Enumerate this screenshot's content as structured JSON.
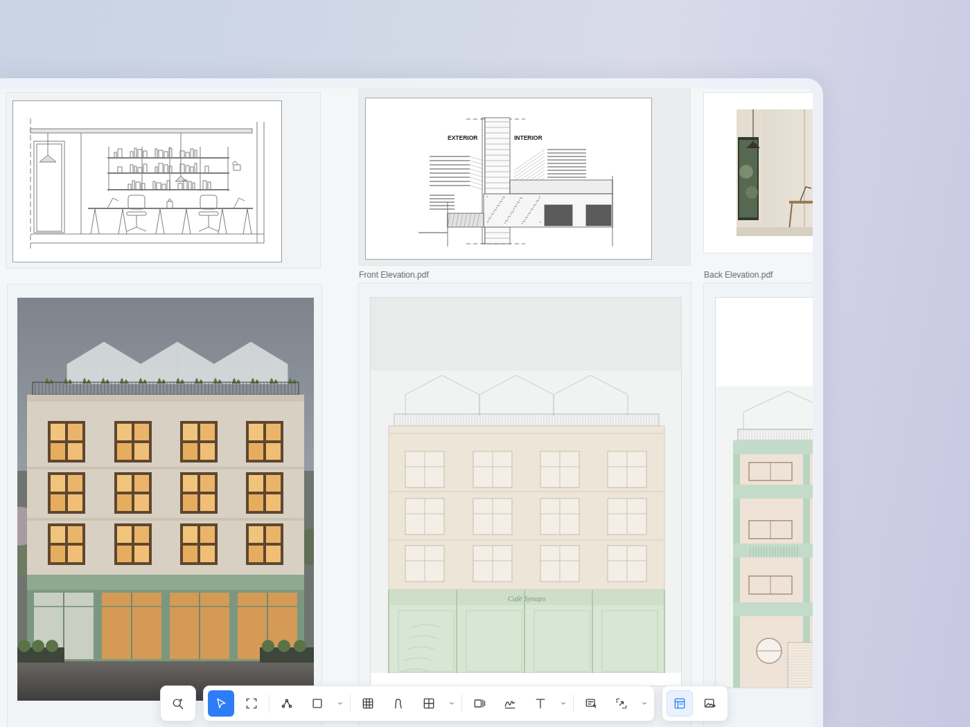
{
  "canvas": {
    "top_row": [
      {
        "kind": "section"
      },
      {
        "kind": "wall-detail",
        "texts": [
          "EXTERIOR",
          "INTERIOR"
        ]
      },
      {
        "kind": "interior-photo"
      }
    ],
    "captions": [
      "Front Elevation.pdf",
      "Back Elevation.pdf"
    ],
    "bottom_row": [
      {
        "kind": "render"
      },
      {
        "kind": "front-elevation",
        "texts": [
          "Café Synaps"
        ]
      },
      {
        "kind": "back-elevation"
      }
    ]
  },
  "toolbar": {
    "groups": [
      {
        "tools": [
          {
            "selected": false,
            "menu": false
          }
        ]
      },
      {
        "tools": [
          {
            "selected": true,
            "menu": false
          },
          {
            "selected": false,
            "menu": false
          },
          {
            "selected": false,
            "menu": false
          },
          {
            "selected": false,
            "menu": true
          },
          {
            "selected": false,
            "menu": false
          },
          {
            "selected": false,
            "menu": false
          },
          {
            "selected": false,
            "menu": true
          },
          {
            "selected": false,
            "menu": false
          },
          {
            "selected": false,
            "menu": false
          },
          {
            "selected": false,
            "menu": true
          },
          {
            "selected": false,
            "menu": false
          },
          {
            "selected": false,
            "menu": true
          }
        ]
      },
      {
        "tools": [
          {
            "selected": true,
            "menu": false
          },
          {
            "selected": false,
            "menu": false
          }
        ]
      }
    ]
  }
}
